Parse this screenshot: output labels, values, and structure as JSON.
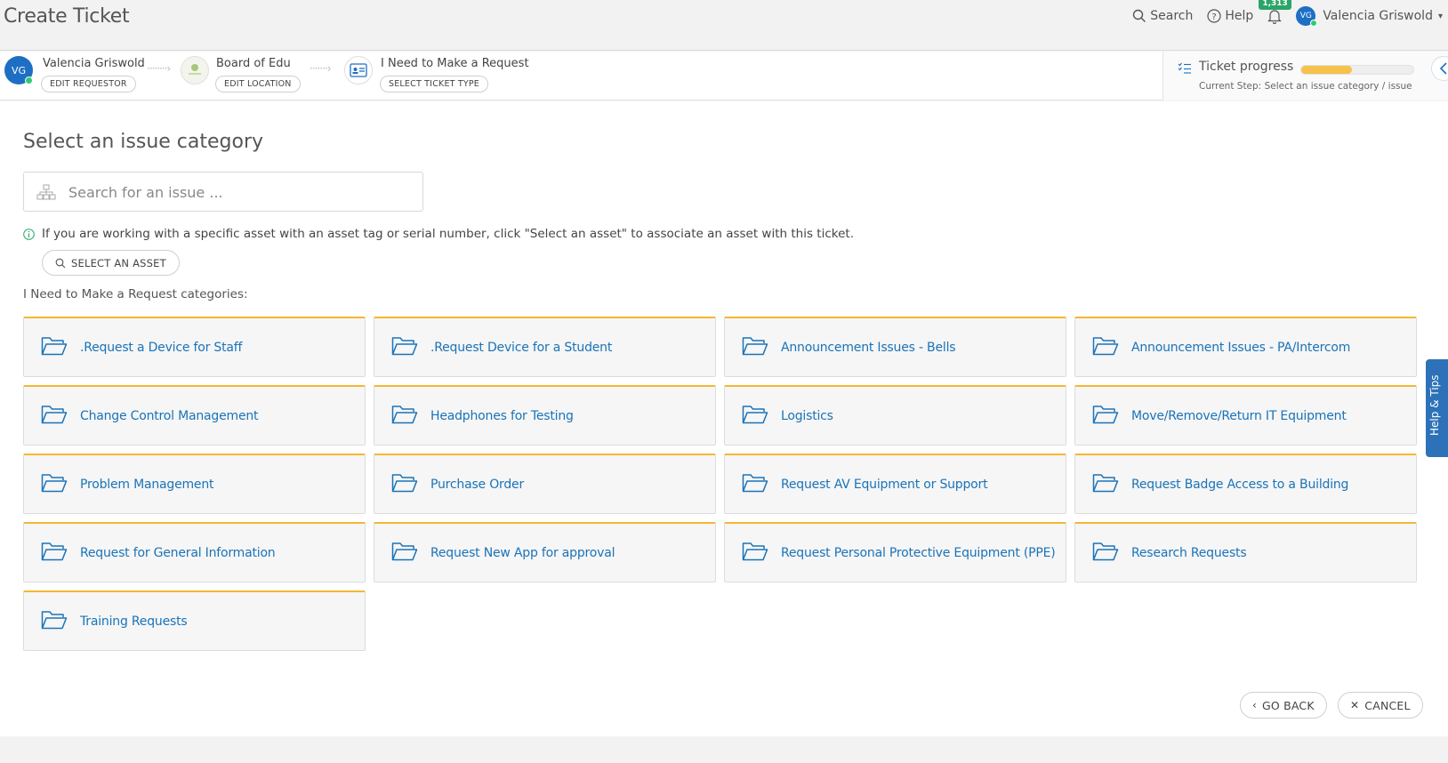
{
  "header": {
    "title": "Create Ticket",
    "search_label": "Search",
    "help_label": "Help",
    "notification_count": "1,313",
    "user_initials": "VG",
    "user_name": "Valencia Griswold"
  },
  "steps": {
    "requestor": {
      "initials": "VG",
      "name": "Valencia Griswold",
      "button": "EDIT REQUESTOR"
    },
    "location": {
      "name": "Board of Edu",
      "button": "EDIT LOCATION"
    },
    "ticket_type": {
      "name": "I Need to Make a Request",
      "button": "SELECT TICKET TYPE"
    }
  },
  "progress": {
    "label": "Ticket progress",
    "fraction": 0.45,
    "current_step_prefix": "Current Step:",
    "current_step": "Select an issue category / issue"
  },
  "main": {
    "section_title": "Select an issue category",
    "search_placeholder": "Search for an issue ...",
    "info_text": "If you are working with a specific asset with an asset tag or serial number, click \"Select an asset\" to associate an asset with this ticket.",
    "select_asset_label": "SELECT AN ASSET",
    "categories_label": "I Need to Make a Request categories:",
    "categories": [
      ".Request a Device for Staff",
      ".Request Device for a Student",
      "Announcement Issues - Bells",
      "Announcement Issues - PA/Intercom",
      "Change Control Management",
      "Headphones for Testing",
      "Logistics",
      "Move/Remove/Return IT Equipment",
      "Problem Management",
      "Purchase Order",
      "Request AV Equipment or Support",
      "Request Badge Access to a Building",
      "Request for General Information",
      "Request New App for approval",
      "Request Personal Protective Equipment (PPE)",
      "Research Requests",
      "Training Requests"
    ]
  },
  "actions": {
    "go_back": "GO BACK",
    "cancel": "CANCEL"
  },
  "help_tab": "Help & Tips",
  "colors": {
    "accent_blue": "#1a73b8",
    "category_border": "#f5b731",
    "progress_fill": "#f5c24c",
    "badge_green": "#2aa567"
  }
}
